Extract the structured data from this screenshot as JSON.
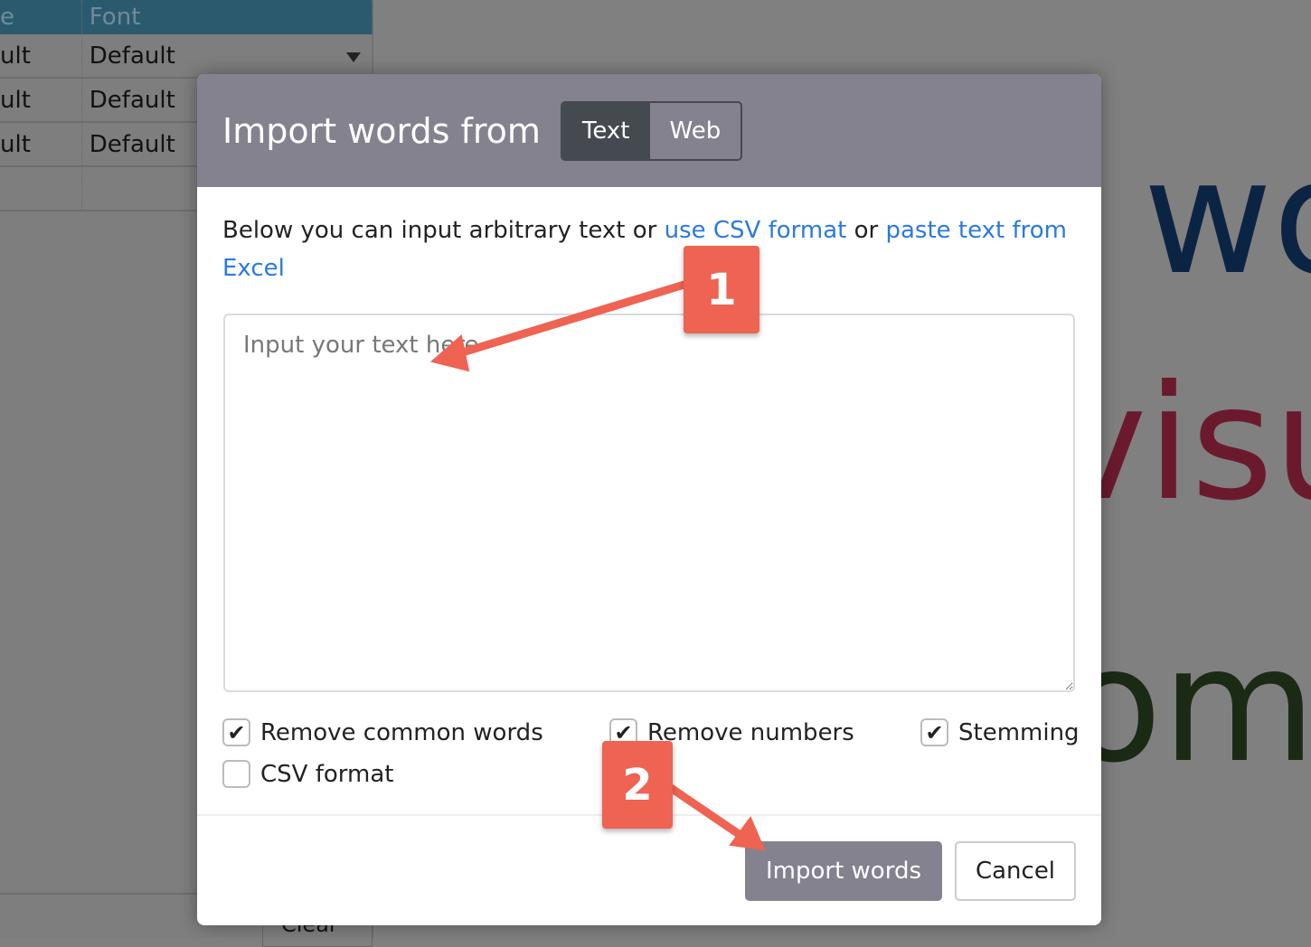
{
  "background": {
    "table": {
      "headers": [
        "e",
        "Font"
      ],
      "rows": [
        [
          "ult",
          "Default"
        ],
        [
          "ult",
          "Default"
        ],
        [
          "ult",
          "Default"
        ]
      ],
      "clear_label": "Clear"
    },
    "words": [
      {
        "text": "t wo",
        "color": "#0c2444"
      },
      {
        "text": "visu",
        "color": "#6b1a2e"
      },
      {
        "text": "rom",
        "color": "#1b2a14"
      }
    ]
  },
  "dialog": {
    "title": "Import words from",
    "tabs": [
      {
        "label": "Text",
        "active": true
      },
      {
        "label": "Web",
        "active": false
      }
    ],
    "intro_prefix": "Below you can input arbitrary text or ",
    "link_csv": "use CSV format",
    "intro_mid": " or ",
    "link_excel": "paste text from Excel",
    "textarea_placeholder": "Input your text here",
    "options": [
      {
        "label": "Remove common words",
        "checked": true
      },
      {
        "label": "Remove numbers",
        "checked": true
      },
      {
        "label": "Stemming",
        "checked": true
      },
      {
        "label": "CSV format",
        "checked": false
      }
    ],
    "import_label": "Import words",
    "cancel_label": "Cancel"
  },
  "annotations": {
    "badge1": "1",
    "badge2": "2",
    "color": "#ee6352"
  }
}
